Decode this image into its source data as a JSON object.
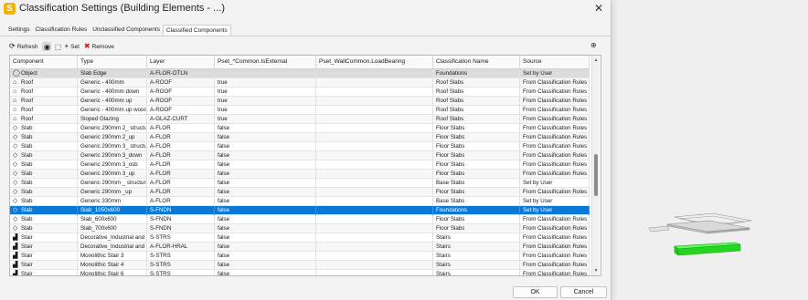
{
  "window": {
    "title": "Classification Settings (Building Elements - ...)",
    "app_icon": "S"
  },
  "tabs": [
    {
      "label": "Settings",
      "active": false
    },
    {
      "label": "Classification Rules",
      "active": false
    },
    {
      "label": "Unclassified Components",
      "active": false
    },
    {
      "label": "Classified Components",
      "active": true
    }
  ],
  "toolbar": {
    "refresh": "Refresh",
    "set": "Set",
    "remove": "Remove"
  },
  "columns": [
    "Component",
    "Type",
    "Layer",
    "Pset_*Common.IsExternal",
    "Pset_WallCommon.LoadBearing",
    "Classification Name",
    "Source"
  ],
  "rows": [
    {
      "icon": "object-icon",
      "glyph": "◯",
      "component": "Object",
      "type": "Slab Edge",
      "layer": "A-FLOR-OTLN",
      "isExternal": "",
      "loadBearing": "",
      "classification": "Foundations",
      "source": "Set by User"
    },
    {
      "icon": "roof-icon",
      "glyph": "⌂",
      "component": "Roof",
      "type": "Generic - 400mm",
      "layer": "A-ROOF",
      "isExternal": "true",
      "loadBearing": "",
      "classification": "Roof Slabs",
      "source": "From Classification Rules"
    },
    {
      "icon": "roof-icon",
      "glyph": "⌂",
      "component": "Roof",
      "type": "Generic - 400mm down",
      "layer": "A-ROOF",
      "isExternal": "true",
      "loadBearing": "",
      "classification": "Roof Slabs",
      "source": "From Classification Rules"
    },
    {
      "icon": "roof-icon",
      "glyph": "⌂",
      "component": "Roof",
      "type": "Generic - 400mm up",
      "layer": "A-ROOF",
      "isExternal": "true",
      "loadBearing": "",
      "classification": "Roof Slabs",
      "source": "From Classification Rules"
    },
    {
      "icon": "roof-icon",
      "glyph": "⌂",
      "component": "Roof",
      "type": "Generic - 400mm up wood",
      "layer": "A-ROOF",
      "isExternal": "true",
      "loadBearing": "",
      "classification": "Roof Slabs",
      "source": "From Classification Rules"
    },
    {
      "icon": "roof-icon",
      "glyph": "⌂",
      "component": "Roof",
      "type": "Sloped Glazing",
      "layer": "A-GLAZ-CURT",
      "isExternal": "true",
      "loadBearing": "",
      "classification": "Roof Slabs",
      "source": "From Classification Rules"
    },
    {
      "icon": "slab-icon",
      "glyph": "◇",
      "component": "Slab",
      "type": "Generic 290mm 2_ structure",
      "layer": "A-FLOR",
      "isExternal": "false",
      "loadBearing": "",
      "classification": "Floor Slabs",
      "source": "From Classification Rules"
    },
    {
      "icon": "slab-icon",
      "glyph": "◇",
      "component": "Slab",
      "type": "Generic 290mm 2_up",
      "layer": "A-FLOR",
      "isExternal": "false",
      "loadBearing": "",
      "classification": "Floor Slabs",
      "source": "From Classification Rules"
    },
    {
      "icon": "slab-icon",
      "glyph": "◇",
      "component": "Slab",
      "type": "Generic 290mm 3_ structure",
      "layer": "A-FLOR",
      "isExternal": "false",
      "loadBearing": "",
      "classification": "Floor Slabs",
      "source": "From Classification Rules"
    },
    {
      "icon": "slab-icon",
      "glyph": "◇",
      "component": "Slab",
      "type": "Generic 290mm 3_down",
      "layer": "A-FLOR",
      "isExternal": "false",
      "loadBearing": "",
      "classification": "Floor Slabs",
      "source": "From Classification Rules"
    },
    {
      "icon": "slab-icon",
      "glyph": "◇",
      "component": "Slab",
      "type": "Generic 290mm 3_osb",
      "layer": "A-FLOR",
      "isExternal": "false",
      "loadBearing": "",
      "classification": "Floor Slabs",
      "source": "From Classification Rules"
    },
    {
      "icon": "slab-icon",
      "glyph": "◇",
      "component": "Slab",
      "type": "Generic 290mm 3_up",
      "layer": "A-FLOR",
      "isExternal": "false",
      "loadBearing": "",
      "classification": "Floor Slabs",
      "source": "From Classification Rules"
    },
    {
      "icon": "slab-icon",
      "glyph": "◇",
      "component": "Slab",
      "type": "Generic 290mm _ structure",
      "layer": "A-FLOR",
      "isExternal": "false",
      "loadBearing": "",
      "classification": "Base Slabs",
      "source": "Set by User"
    },
    {
      "icon": "slab-icon",
      "glyph": "◇",
      "component": "Slab",
      "type": "Generic 290mm _up",
      "layer": "A-FLOR",
      "isExternal": "false",
      "loadBearing": "",
      "classification": "Floor Slabs",
      "source": "From Classification Rules"
    },
    {
      "icon": "slab-icon",
      "glyph": "◇",
      "component": "Slab",
      "type": "Generic 330mm",
      "layer": "A-FLOR",
      "isExternal": "false",
      "loadBearing": "",
      "classification": "Base Slabs",
      "source": "Set by User"
    },
    {
      "icon": "slab-icon",
      "glyph": "◇",
      "component": "Slab",
      "type": "Slab_1050x600",
      "layer": "S-FNDN",
      "isExternal": "false",
      "loadBearing": "",
      "classification": "Foundations",
      "source": "Set by User",
      "selected": true
    },
    {
      "icon": "slab-icon",
      "glyph": "◇",
      "component": "Slab",
      "type": "Slab_600x600",
      "layer": "S-FNDN",
      "isExternal": "false",
      "loadBearing": "",
      "classification": "Floor Slabs",
      "source": "From Classification Rules"
    },
    {
      "icon": "slab-icon",
      "glyph": "◇",
      "component": "Slab",
      "type": "Slab_700x600",
      "layer": "S-FNDN",
      "isExternal": "false",
      "loadBearing": "",
      "classification": "Floor Slabs",
      "source": "From Classification Rules"
    },
    {
      "icon": "stair-icon",
      "glyph": "▟",
      "component": "Stair",
      "type": "Decorative_Industrial and ...",
      "layer": "S-STRS",
      "isExternal": "false",
      "loadBearing": "",
      "classification": "Stairs",
      "source": "From Classification Rules"
    },
    {
      "icon": "stair-icon",
      "glyph": "▟",
      "component": "Stair",
      "type": "Decorative_Industrial and ...",
      "layer": "A-FLOR-HRAL",
      "isExternal": "false",
      "loadBearing": "",
      "classification": "Stairs",
      "source": "From Classification Rules"
    },
    {
      "icon": "stair-icon",
      "glyph": "▟",
      "component": "Stair",
      "type": "Monolithic Stair 3",
      "layer": "S-STRS",
      "isExternal": "false",
      "loadBearing": "",
      "classification": "Stairs",
      "source": "From Classification Rules"
    },
    {
      "icon": "stair-icon",
      "glyph": "▟",
      "component": "Stair",
      "type": "Monolithic Stair 4",
      "layer": "S-STRS",
      "isExternal": "false",
      "loadBearing": "",
      "classification": "Stairs",
      "source": "From Classification Rules"
    },
    {
      "icon": "stair-icon",
      "glyph": "▟",
      "component": "Stair",
      "type": "Monolithic Stair 6",
      "layer": "S-STRS",
      "isExternal": "false",
      "loadBearing": "",
      "classification": "Stairs",
      "source": "From Classification Rules"
    }
  ],
  "buttons": {
    "ok": "OK",
    "cancel": "Cancel"
  },
  "colors": {
    "selection": "#0a78d7",
    "highlight_model": "#22d61e",
    "app_icon": "#f2b400"
  }
}
